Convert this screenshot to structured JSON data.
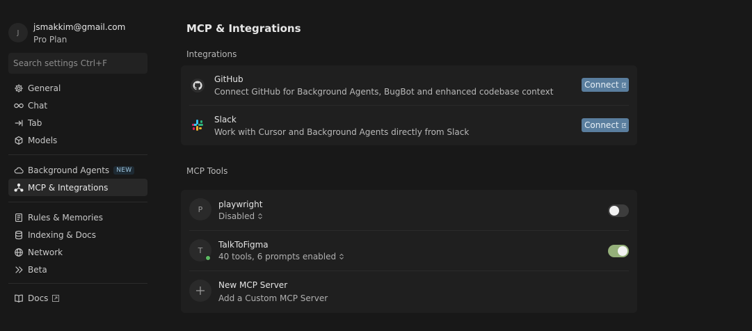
{
  "account": {
    "avatar_letter": "J",
    "email": "jsmakkim@gmail.com",
    "plan": "Pro Plan"
  },
  "search": {
    "placeholder": "Search settings Ctrl+F"
  },
  "sidebar": {
    "items": [
      {
        "label": "General",
        "icon": "gear-icon"
      },
      {
        "label": "Chat",
        "icon": "infinity-icon"
      },
      {
        "label": "Tab",
        "icon": "arrow-right-bar-icon"
      },
      {
        "label": "Models",
        "icon": "cube-icon"
      },
      {
        "label": "Background Agents",
        "icon": "cloud-icon",
        "badge": "NEW"
      },
      {
        "label": "MCP & Integrations",
        "icon": "mcp-icon",
        "active": true
      },
      {
        "label": "Rules & Memories",
        "icon": "document-icon"
      },
      {
        "label": "Indexing & Docs",
        "icon": "database-icon"
      },
      {
        "label": "Network",
        "icon": "globe-icon"
      },
      {
        "label": "Beta",
        "icon": "chevrons-right-icon"
      },
      {
        "label": "Docs",
        "icon": "book-icon",
        "external": true
      }
    ]
  },
  "main": {
    "title": "MCP & Integrations",
    "integrations_label": "Integrations",
    "integrations": [
      {
        "name": "GitHub",
        "description": "Connect GitHub for Background Agents, BugBot and enhanced codebase context",
        "button": "Connect",
        "icon": "github-icon"
      },
      {
        "name": "Slack",
        "description": "Work with Cursor and Background Agents directly from Slack",
        "button": "Connect",
        "icon": "slack-icon"
      }
    ],
    "mcp_label": "MCP Tools",
    "mcp_tools": [
      {
        "avatar": "P",
        "name": "playwright",
        "status": "Disabled",
        "enabled": false
      },
      {
        "avatar": "T",
        "name": "TalkToFigma",
        "status": "40 tools, 6 prompts enabled",
        "enabled": true,
        "online": true
      }
    ],
    "new_server": {
      "name": "New MCP Server",
      "description": "Add a Custom MCP Server"
    }
  },
  "colors": {
    "background": "#181818",
    "card": "#1f1f1f",
    "connect_button": "#5a7e9e",
    "toggle_on": "#95b07a",
    "status_online": "#5dbb63"
  }
}
